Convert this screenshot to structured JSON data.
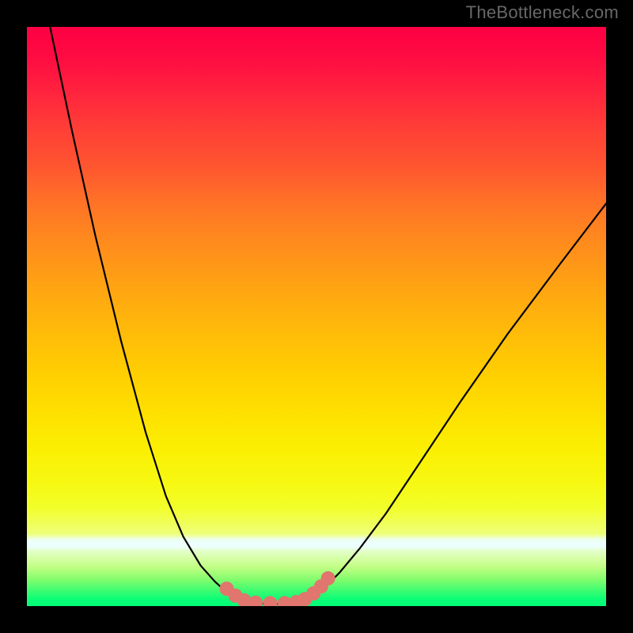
{
  "watermark": "TheBottleneck.com",
  "chart_data": {
    "type": "line",
    "title": "",
    "xlabel": "",
    "ylabel": "",
    "xlim": [
      0,
      1
    ],
    "ylim": [
      0,
      1
    ],
    "series": [
      {
        "name": "curve",
        "color": "#000000",
        "x": [
          0.04,
          0.078,
          0.118,
          0.162,
          0.205,
          0.24,
          0.27,
          0.3,
          0.325,
          0.345,
          0.362,
          0.378,
          0.41,
          0.445,
          0.47,
          0.485,
          0.51,
          0.54,
          0.575,
          0.62,
          0.68,
          0.75,
          0.83,
          0.92,
          1.0
        ],
        "y": [
          1.0,
          0.82,
          0.64,
          0.46,
          0.3,
          0.19,
          0.12,
          0.07,
          0.042,
          0.024,
          0.014,
          0.008,
          0.004,
          0.004,
          0.007,
          0.012,
          0.028,
          0.058,
          0.1,
          0.16,
          0.25,
          0.355,
          0.47,
          0.59,
          0.695
        ]
      }
    ],
    "markers": [
      {
        "name": "salmon-dots",
        "color": "#e0766d",
        "radius_px": 9,
        "points": [
          {
            "x": 0.345,
            "y": 0.03
          },
          {
            "x": 0.36,
            "y": 0.018
          },
          {
            "x": 0.375,
            "y": 0.01
          },
          {
            "x": 0.395,
            "y": 0.006
          },
          {
            "x": 0.42,
            "y": 0.005
          },
          {
            "x": 0.445,
            "y": 0.005
          },
          {
            "x": 0.465,
            "y": 0.007
          },
          {
            "x": 0.48,
            "y": 0.012
          },
          {
            "x": 0.495,
            "y": 0.022
          },
          {
            "x": 0.508,
            "y": 0.034
          },
          {
            "x": 0.52,
            "y": 0.048
          }
        ]
      }
    ],
    "background_gradient": {
      "top": "#fe0043",
      "middle": "#fee100",
      "bottom": "#02fe77"
    }
  }
}
